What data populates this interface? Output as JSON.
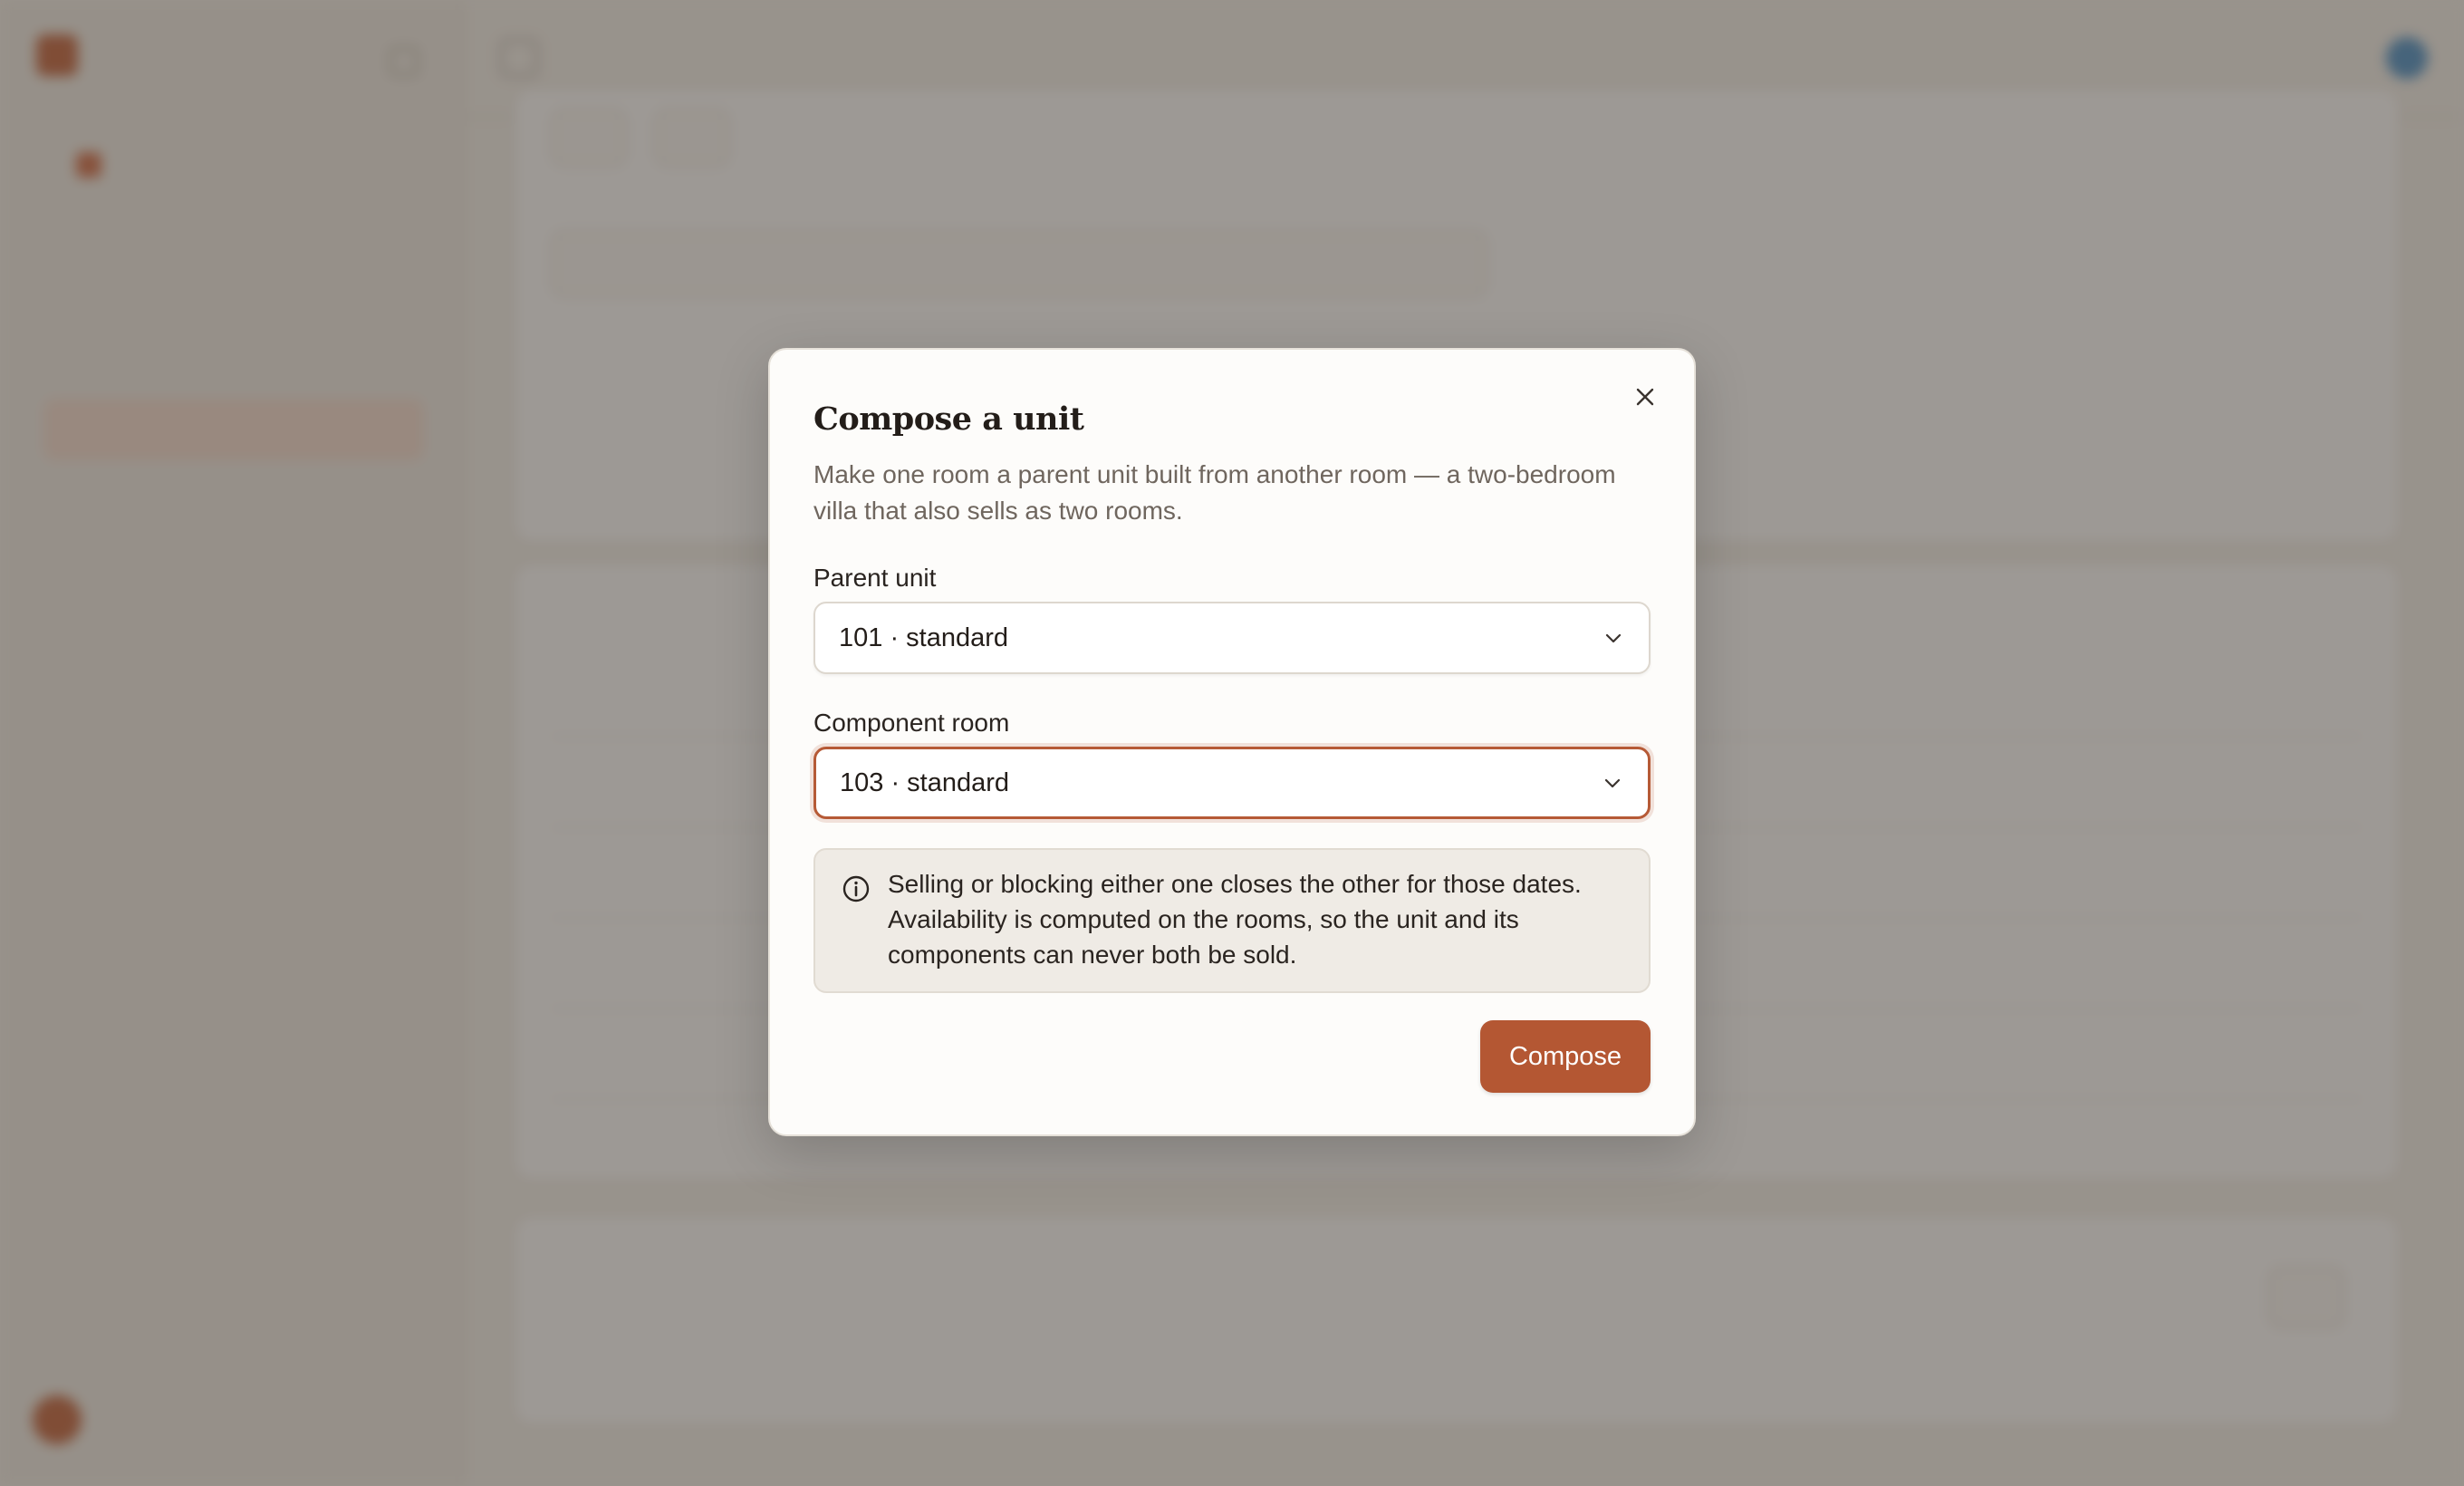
{
  "colors": {
    "accent": "#b45733",
    "focus_border": "#b65a36",
    "dialog_background": "#fdfcfa",
    "info_background": "#efebe5",
    "overlay": "rgba(68,60,52,0.52)"
  },
  "dialog": {
    "title": "Compose a unit",
    "description": "Make one room a parent unit built from another room — a two-bedroom villa that also sells as two rooms.",
    "close_icon": "close-icon",
    "parent_unit": {
      "label": "Parent unit",
      "value": "101 · standard",
      "icon": "chevron-down-icon"
    },
    "component_room": {
      "label": "Component room",
      "value": "103 · standard",
      "icon": "chevron-down-icon"
    },
    "info": {
      "icon": "info-icon",
      "text": "Selling or blocking either one closes the other for those dates. Availability is computed on the rooms, so the unit and its components can never both be sold."
    },
    "submit_label": "Compose"
  }
}
